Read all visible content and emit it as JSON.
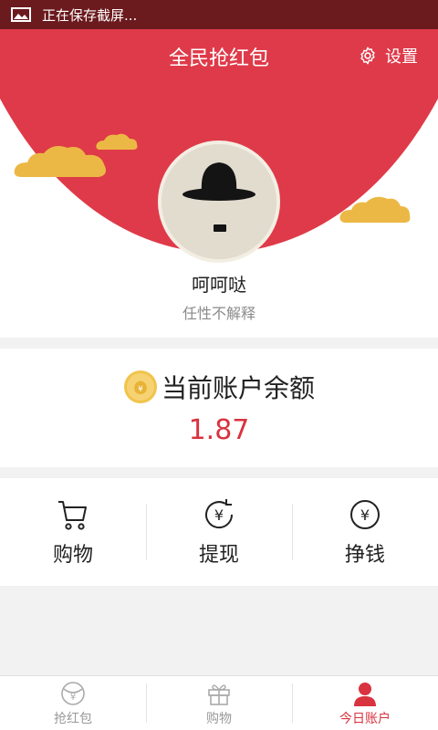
{
  "status_bar": {
    "text": "正在保存截屏...",
    "icon": "image-icon"
  },
  "header": {
    "title": "全民抢红包",
    "settings_label": "设置",
    "settings_icon": "gear-icon",
    "accent_color": "#df3a49"
  },
  "profile": {
    "name": "呵呵哒",
    "signature": "任性不解释",
    "avatar_icon": "bowler-hat-avatar"
  },
  "balance": {
    "title": "当前账户余额",
    "value": "1.87",
    "icon": "coin-bag-icon",
    "value_color": "#d9333f"
  },
  "actions": [
    {
      "label": "购物",
      "icon": "cart-icon"
    },
    {
      "label": "提现",
      "icon": "yuan-refresh-icon"
    },
    {
      "label": "挣钱",
      "icon": "yuan-circle-icon"
    }
  ],
  "bottom_nav": [
    {
      "label": "抢红包",
      "icon": "yuan-envelope-icon",
      "active": false
    },
    {
      "label": "购物",
      "icon": "gift-icon",
      "active": false
    },
    {
      "label": "今日账户",
      "icon": "user-icon",
      "active": true
    }
  ]
}
